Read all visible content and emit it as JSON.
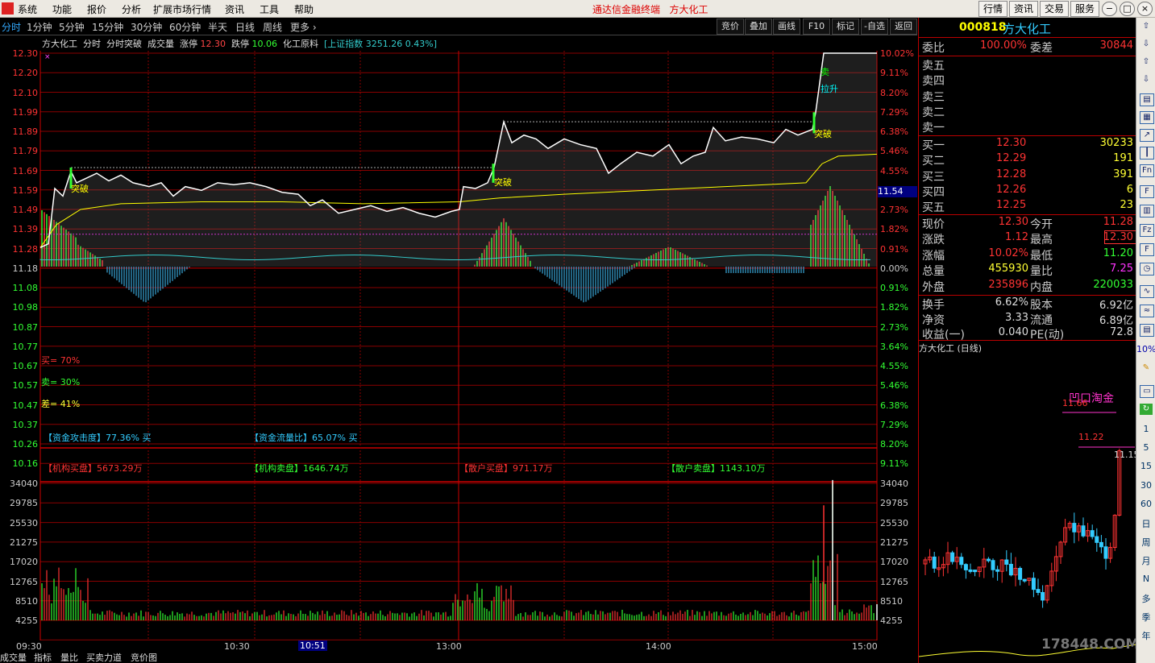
{
  "app": {
    "menu": [
      "系统",
      "功能",
      "报价",
      "分析",
      "扩展市场行情",
      "资讯",
      "工具",
      "帮助"
    ],
    "title": "通达信金融终端",
    "stock_name": "方大化工",
    "top_buttons": [
      "行情",
      "资讯",
      "交易",
      "服务"
    ],
    "window_buttons": [
      "−",
      "□",
      "×"
    ]
  },
  "periods": [
    "分时",
    "1分钟",
    "5分钟",
    "15分钟",
    "30分钟",
    "60分钟",
    "半天",
    "日线",
    "周线",
    "更多"
  ],
  "active_period": "分时",
  "right_tools": [
    "竞价",
    "叠加",
    "画线",
    "F10",
    "标记",
    "-自选",
    "返回"
  ],
  "info_line": {
    "name": "方大化工",
    "mode": "分时",
    "indicator": "分时突破",
    "vol": "成交量",
    "limit_up_label": "涨停",
    "limit_up": "12.30",
    "limit_down_label": "跌停",
    "limit_down": "10.06",
    "sector": "化工原料",
    "index": "[上证指数 3251.26 0.43%]"
  },
  "price_axis": {
    "left": [
      "12.30",
      "12.20",
      "12.10",
      "11.99",
      "11.89",
      "11.79",
      "11.69",
      "11.59",
      "11.49",
      "11.39",
      "11.28",
      "11.18",
      "11.08",
      "10.98",
      "10.87",
      "10.77",
      "10.67",
      "10.57",
      "10.47",
      "10.37",
      "10.26",
      "10.16"
    ],
    "right": [
      "10.02%",
      "9.11%",
      "8.20%",
      "7.29%",
      "6.38%",
      "5.46%",
      "4.55%",
      "3.64%",
      "2.73%",
      "1.82%",
      "0.91%",
      "0.00%",
      "0.91%",
      "1.82%",
      "2.73%",
      "3.64%",
      "4.55%",
      "5.46%",
      "6.38%",
      "7.29%",
      "8.20%",
      "9.11%"
    ],
    "current_price_tag": "11.54"
  },
  "volume_axis": [
    "34040",
    "29785",
    "25530",
    "21275",
    "17020",
    "12765",
    "8510",
    "4255"
  ],
  "time_axis": [
    "09:30",
    "10:30",
    "10:51",
    "13:00",
    "14:00",
    "15:00"
  ],
  "chart_signals": {
    "breakout": "突破",
    "sell": "卖",
    "pull_up": "拉升",
    "sell_mark": "×"
  },
  "indicators": {
    "buy": "买= 70%",
    "sell": "卖= 30%",
    "diff": "差= 41%",
    "attack": "【资金攻击度】77.36% 买",
    "flow": "【资金流量比】65.07% 买",
    "inst_buy": "【机构买盘】5673.29万",
    "inst_sell": "【机构卖盘】1646.74万",
    "retail_buy": "【散户买盘】971.17万",
    "retail_sell": "【散户卖盘】1143.10万"
  },
  "quote": {
    "code": "000818",
    "name": "方大化工",
    "weibi_label": "委比",
    "weibi": "100.00%",
    "weicha_label": "委差",
    "weicha": "30844",
    "asks": [
      {
        "label": "卖五",
        "price": "",
        "vol": ""
      },
      {
        "label": "卖四",
        "price": "",
        "vol": ""
      },
      {
        "label": "卖三",
        "price": "",
        "vol": ""
      },
      {
        "label": "卖二",
        "price": "",
        "vol": ""
      },
      {
        "label": "卖一",
        "price": "",
        "vol": ""
      }
    ],
    "bids": [
      {
        "label": "买一",
        "price": "12.30",
        "vol": "30233"
      },
      {
        "label": "买二",
        "price": "12.29",
        "vol": "191"
      },
      {
        "label": "买三",
        "price": "12.28",
        "vol": "391"
      },
      {
        "label": "买四",
        "price": "12.26",
        "vol": "6"
      },
      {
        "label": "买五",
        "price": "12.25",
        "vol": "23"
      }
    ],
    "stats": [
      {
        "l1": "现价",
        "v1": "12.30",
        "l2": "今开",
        "v2": "11.28"
      },
      {
        "l1": "涨跌",
        "v1": "1.12",
        "l2": "最高",
        "v2": "12.30"
      },
      {
        "l1": "涨幅",
        "v1": "10.02%",
        "l2": "最低",
        "v2": "11.20"
      },
      {
        "l1": "总量",
        "v1": "455930",
        "l2": "量比",
        "v2": "7.25"
      },
      {
        "l1": "外盘",
        "v1": "235896",
        "l2": "内盘",
        "v2": "220033"
      }
    ],
    "fin": [
      {
        "l1": "换手",
        "v1": "6.62%",
        "l2": "股本",
        "v2": "6.92亿"
      },
      {
        "l1": "净资",
        "v1": "3.33",
        "l2": "流通",
        "v2": "6.89亿"
      },
      {
        "l1": "收益(一)",
        "v1": "0.040",
        "l2": "PE(动)",
        "v2": "72.8"
      }
    ],
    "daily_title": "方大化工 (日线)",
    "daily_labels": {
      "gap": "凹口淘金",
      "high": "11.66",
      "mid": "11.22",
      "last": "11.15"
    }
  },
  "side_items": [
    "1",
    "5",
    "15",
    "30",
    "60",
    "日",
    "周",
    "月",
    "N",
    "多",
    "季",
    "年"
  ],
  "side_pct": "10%",
  "bottom_tabs": [
    "成交量",
    "指标",
    "量比",
    "买卖力道",
    "竞价图"
  ],
  "watermark": "178448.COM",
  "colors": {
    "up": "#ff3333",
    "down": "#33ff33",
    "line": "#ffffff",
    "avg": "#ffff00",
    "grid": "#8a0000",
    "accent": "#ffff00"
  }
}
